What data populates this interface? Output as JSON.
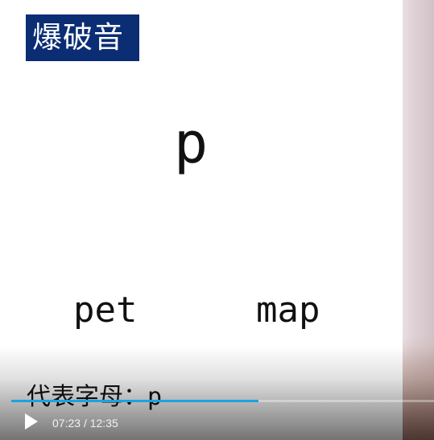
{
  "slide": {
    "title": "爆破音",
    "main_letter": "p",
    "examples": [
      "pet",
      "map"
    ],
    "caption_label": "代表字母：",
    "caption_letter": "p"
  },
  "player": {
    "current_time": "07:23",
    "separator": "/",
    "duration": "12:35",
    "progress_fraction": 0.585,
    "accent_color": "#1aa3e0",
    "play_icon": "play-icon"
  },
  "colors": {
    "title_background": "#0b2d74",
    "title_text": "#ffffff",
    "slide_background": "#ffffff",
    "text": "#111111"
  }
}
